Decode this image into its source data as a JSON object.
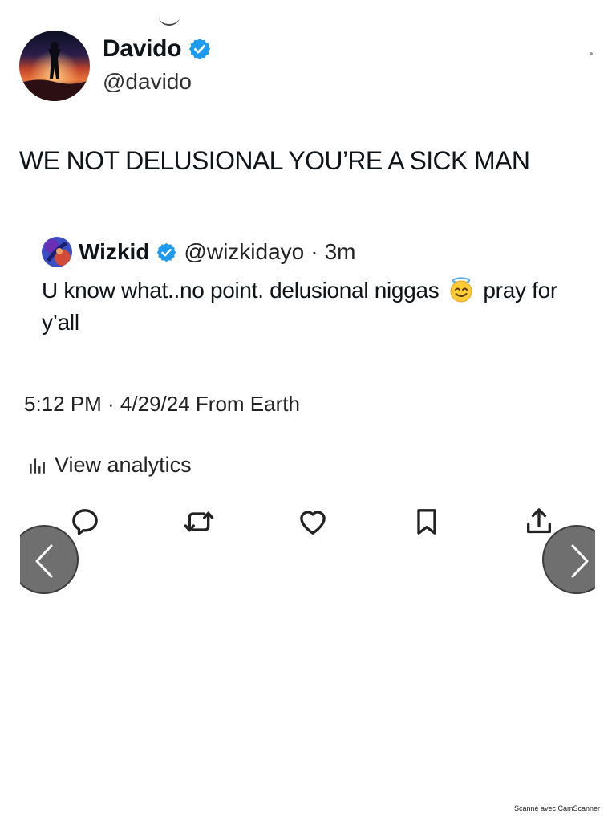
{
  "tweet": {
    "author": {
      "display_name": "Davido",
      "handle": "@davido",
      "verified": true,
      "avatar_icon": "sunset-silhouette-avatar"
    },
    "text": "WE NOT DELUSIONAL YOU’RE A SICK MAN",
    "quoted": {
      "display_name": "Wizkid",
      "handle": "@wizkidayo",
      "separator": "·",
      "time": "3m",
      "verified": true,
      "text_before_emoji": "U know what..no point. delusional niggas",
      "emoji_icon": "smiling-face-with-halo-icon",
      "text_after_emoji": "pray for y’all"
    },
    "meta": "5:12 PM · 4/29/24 From Earth",
    "analytics_label": "View analytics",
    "actions": [
      "reply-icon",
      "retweet-icon",
      "like-icon",
      "bookmark-icon",
      "share-icon"
    ]
  },
  "navigation": {
    "prev_icon": "chevron-left-icon",
    "next_icon": "chevron-right-icon"
  },
  "watermark": "Scanné avec CamScanner",
  "colors": {
    "verified_blue": "#1d9bf0",
    "text": "#0f1419",
    "nav_button": "#6f6f6f"
  }
}
